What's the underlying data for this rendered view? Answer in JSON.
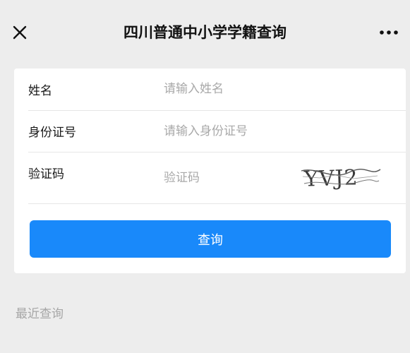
{
  "nav": {
    "title": "四川普通中小学学籍查询",
    "close_icon": "close-icon",
    "more_icon": "more-horizontal-icon"
  },
  "form": {
    "name_label": "姓名",
    "name_placeholder": "请输入姓名",
    "name_value": "",
    "id_label": "身份证号",
    "id_placeholder": "请输入身份证号",
    "id_value": "",
    "captcha_label": "验证码",
    "captcha_placeholder": "验证码",
    "captcha_value": "",
    "captcha_image_text": "YVJ2"
  },
  "actions": {
    "submit_label": "查询"
  },
  "recent": {
    "title": "最近查询"
  },
  "colors": {
    "primary": "#1989fa",
    "page_bg": "#ededed",
    "card_bg": "#ffffff",
    "placeholder": "#a9a9a9",
    "muted_text": "#a6a6a6"
  }
}
